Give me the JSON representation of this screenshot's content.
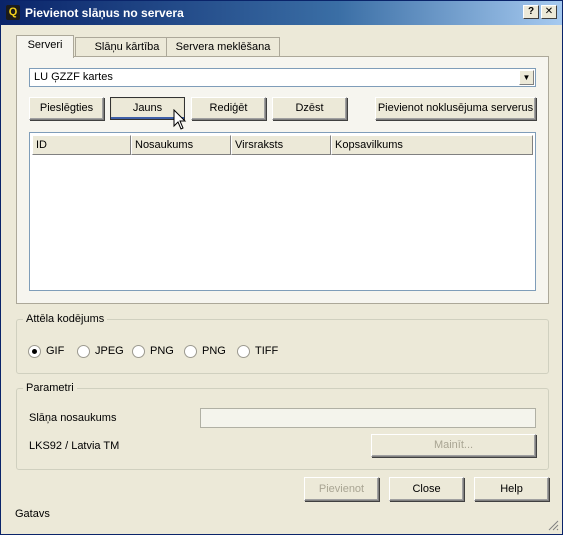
{
  "window": {
    "title": "Pievienot slāņus no servera",
    "help_btn": "?",
    "close_btn": "✕"
  },
  "tabs": [
    {
      "label": "Serveri",
      "active": true
    },
    {
      "label": "Slāņu kārtība",
      "active": false
    },
    {
      "label": "Servera meklēšana",
      "active": false
    }
  ],
  "server_select": {
    "value": "LU ĢZZF kartes"
  },
  "server_buttons": {
    "connect": "Pieslēgties",
    "new": "Jauns",
    "edit": "Rediģēt",
    "delete": "Dzēst",
    "add_default": "Pievienot noklusējuma serverus"
  },
  "layers_table": {
    "columns": [
      "ID",
      "Nosaukums",
      "Virsraksts",
      "Kopsavilkums"
    ],
    "rows": []
  },
  "encoding": {
    "legend": "Attēla kodējums",
    "options": [
      {
        "label": "GIF",
        "checked": true
      },
      {
        "label": "JPEG",
        "checked": false
      },
      {
        "label": "PNG",
        "checked": false
      },
      {
        "label": "PNG",
        "checked": false
      },
      {
        "label": "TIFF",
        "checked": false
      }
    ]
  },
  "params": {
    "legend": "Parametri",
    "layer_name_label": "Slāņa nosaukums",
    "layer_name_value": "",
    "crs_label": "LKS92 / Latvia TM",
    "change_button": "Mainīt..."
  },
  "dialog_buttons": {
    "add": "Pievienot",
    "close": "Close",
    "help": "Help"
  },
  "status": "Gatavs",
  "colors": {
    "titlebar_start": "#0a246a",
    "titlebar_end": "#a6caf0",
    "dialog_bg": "#ece9d8",
    "panel_bg": "#f6f5ef"
  }
}
